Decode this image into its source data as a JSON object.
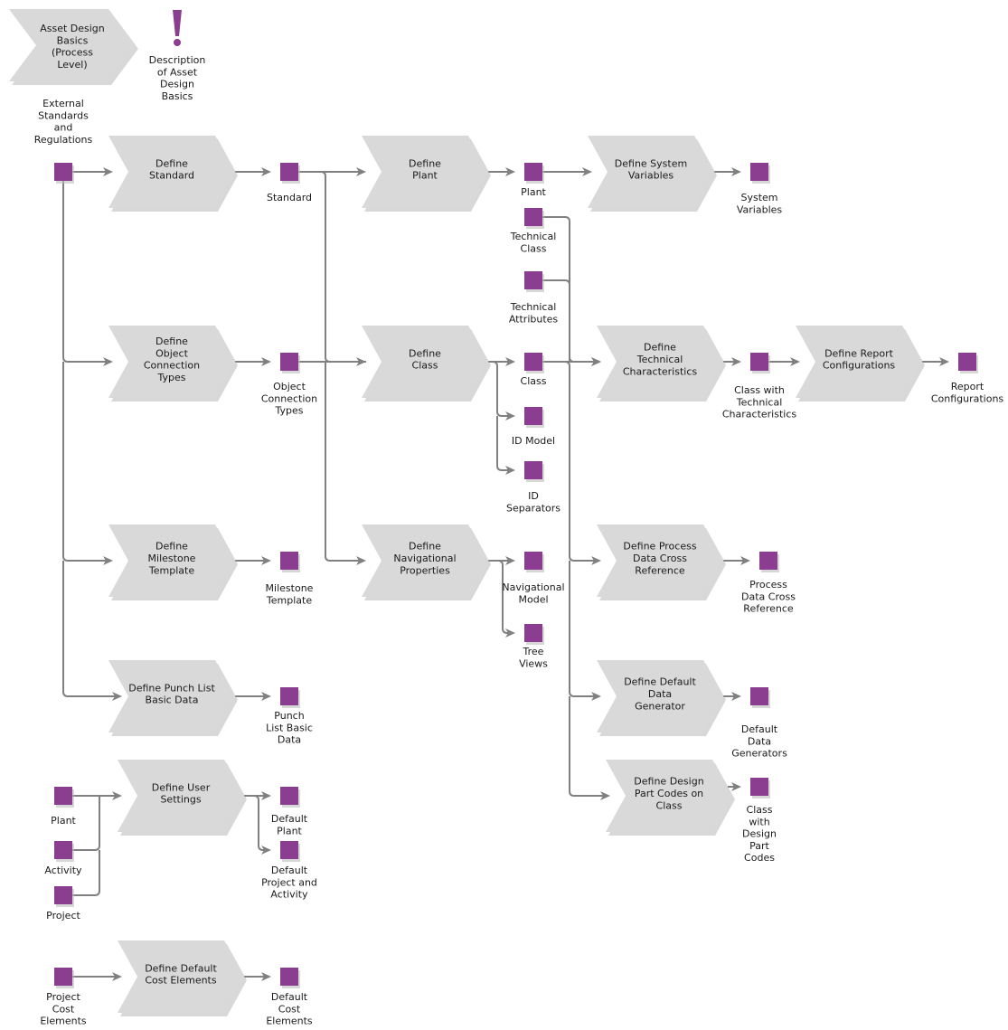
{
  "diagram": {
    "title": "Asset Design Basics (Process Level)",
    "colors": {
      "function_fill": "#d9d9d9",
      "object_fill": "#8b3d8f",
      "edge": "#808080",
      "text": "#1a1a1a"
    },
    "header": {
      "process_label": [
        "Asset Design",
        "Basics",
        "(Process",
        "Level)"
      ],
      "description_icon": "exclamation-icon",
      "description_label": [
        "Description",
        "of Asset",
        "Design",
        "Basics"
      ]
    },
    "functions": [
      {
        "id": "f_std",
        "label": [
          "Define",
          "Standard"
        ]
      },
      {
        "id": "f_plant",
        "label": [
          "Define",
          "Plant"
        ]
      },
      {
        "id": "f_sysvar",
        "label": [
          "Define System",
          "Variables"
        ]
      },
      {
        "id": "f_oct",
        "label": [
          "Define",
          "Object",
          "Connection",
          "Types"
        ]
      },
      {
        "id": "f_class",
        "label": [
          "Define",
          "Class"
        ]
      },
      {
        "id": "f_techch",
        "label": [
          "Define",
          "Technical",
          "Characteristics"
        ]
      },
      {
        "id": "f_report",
        "label": [
          "Define Report",
          "Configurations"
        ]
      },
      {
        "id": "f_mile",
        "label": [
          "Define",
          "Milestone",
          "Template"
        ]
      },
      {
        "id": "f_nav",
        "label": [
          "Define",
          "Navigational",
          "Properties"
        ]
      },
      {
        "id": "f_pdcr",
        "label": [
          "Define Process",
          "Data Cross",
          "Reference"
        ]
      },
      {
        "id": "f_punch",
        "label": [
          "Define Punch List",
          "Basic Data"
        ]
      },
      {
        "id": "f_ddg",
        "label": [
          "Define Default",
          "Data",
          "Generator"
        ]
      },
      {
        "id": "f_user",
        "label": [
          "Define User",
          "Settings"
        ]
      },
      {
        "id": "f_dpc",
        "label": [
          "Define Design",
          "Part Codes on",
          "Class"
        ]
      },
      {
        "id": "f_cost",
        "label": [
          "Define Default",
          "Cost Elements"
        ]
      }
    ],
    "objects": [
      {
        "id": "o_ext",
        "label": [
          "External",
          "Standards",
          "and",
          "Regulations"
        ]
      },
      {
        "id": "o_std",
        "label": [
          "Standard"
        ]
      },
      {
        "id": "o_plant",
        "label": [
          "Plant"
        ]
      },
      {
        "id": "o_sysvar",
        "label": [
          "System",
          "Variables"
        ]
      },
      {
        "id": "o_tclass",
        "label": [
          "Technical",
          "Class"
        ]
      },
      {
        "id": "o_tattr",
        "label": [
          "Technical",
          "Attributes"
        ]
      },
      {
        "id": "o_oct",
        "label": [
          "Object",
          "Connection",
          "Types"
        ]
      },
      {
        "id": "o_class",
        "label": [
          "Class"
        ]
      },
      {
        "id": "o_cwtc",
        "label": [
          "Class with",
          "Technical",
          "Characteristics"
        ]
      },
      {
        "id": "o_report",
        "label": [
          "Report",
          "Configurations"
        ]
      },
      {
        "id": "o_idmodel",
        "label": [
          "ID Model"
        ]
      },
      {
        "id": "o_idsep",
        "label": [
          "ID",
          "Separators"
        ]
      },
      {
        "id": "o_mile",
        "label": [
          "Milestone",
          "Template"
        ]
      },
      {
        "id": "o_navm",
        "label": [
          "Navigational",
          "Model"
        ]
      },
      {
        "id": "o_pdcr",
        "label": [
          "Process",
          "Data Cross",
          "Reference"
        ]
      },
      {
        "id": "o_tree",
        "label": [
          "Tree",
          "Views"
        ]
      },
      {
        "id": "o_punch",
        "label": [
          "Punch",
          "List Basic",
          "Data"
        ]
      },
      {
        "id": "o_ddg",
        "label": [
          "Default",
          "Data",
          "Generators"
        ]
      },
      {
        "id": "o_uplant",
        "label": [
          "Plant"
        ]
      },
      {
        "id": "o_activity",
        "label": [
          "Activity"
        ]
      },
      {
        "id": "o_project",
        "label": [
          "Project"
        ]
      },
      {
        "id": "o_dplant",
        "label": [
          "Default",
          "Plant"
        ]
      },
      {
        "id": "o_dpa",
        "label": [
          "Default",
          "Project and",
          "Activity"
        ]
      },
      {
        "id": "o_cwdpc",
        "label": [
          "Class",
          "with",
          "Design",
          "Part",
          "Codes"
        ]
      },
      {
        "id": "o_pce",
        "label": [
          "Project",
          "Cost",
          "Elements"
        ]
      },
      {
        "id": "o_dce",
        "label": [
          "Default",
          "Cost",
          "Elements"
        ]
      }
    ],
    "connections": [
      {
        "from": "o_ext",
        "to": "f_std"
      },
      {
        "from": "o_ext",
        "to": "f_oct"
      },
      {
        "from": "o_ext",
        "to": "f_mile"
      },
      {
        "from": "o_ext",
        "to": "f_punch"
      },
      {
        "from": "f_std",
        "to": "o_std"
      },
      {
        "from": "o_std",
        "to": "f_plant"
      },
      {
        "from": "o_std",
        "to": "f_class"
      },
      {
        "from": "o_std",
        "to": "f_nav"
      },
      {
        "from": "f_plant",
        "to": "o_plant"
      },
      {
        "from": "o_plant",
        "to": "f_sysvar"
      },
      {
        "from": "f_sysvar",
        "to": "o_sysvar"
      },
      {
        "from": "f_oct",
        "to": "o_oct"
      },
      {
        "from": "o_oct",
        "to": "f_class"
      },
      {
        "from": "f_class",
        "to": "o_class"
      },
      {
        "from": "f_class",
        "to": "o_idmodel"
      },
      {
        "from": "f_class",
        "to": "o_idsep"
      },
      {
        "from": "o_tclass",
        "to": "f_techch"
      },
      {
        "from": "o_tattr",
        "to": "f_techch"
      },
      {
        "from": "o_class",
        "to": "f_techch"
      },
      {
        "from": "o_class",
        "to": "f_pdcr"
      },
      {
        "from": "o_class",
        "to": "f_ddg"
      },
      {
        "from": "o_class",
        "to": "f_dpc"
      },
      {
        "from": "f_techch",
        "to": "o_cwtc"
      },
      {
        "from": "o_cwtc",
        "to": "f_report"
      },
      {
        "from": "f_report",
        "to": "o_report"
      },
      {
        "from": "f_mile",
        "to": "o_mile"
      },
      {
        "from": "f_nav",
        "to": "o_navm"
      },
      {
        "from": "f_nav",
        "to": "o_tree"
      },
      {
        "from": "f_pdcr",
        "to": "o_pdcr"
      },
      {
        "from": "f_punch",
        "to": "o_punch"
      },
      {
        "from": "f_ddg",
        "to": "o_ddg"
      },
      {
        "from": "o_uplant",
        "to": "f_user"
      },
      {
        "from": "o_activity",
        "to": "f_user"
      },
      {
        "from": "o_project",
        "to": "f_user"
      },
      {
        "from": "f_user",
        "to": "o_dplant"
      },
      {
        "from": "f_user",
        "to": "o_dpa"
      },
      {
        "from": "f_dpc",
        "to": "o_cwdpc"
      },
      {
        "from": "o_pce",
        "to": "f_cost"
      },
      {
        "from": "f_cost",
        "to": "o_dce"
      }
    ]
  }
}
